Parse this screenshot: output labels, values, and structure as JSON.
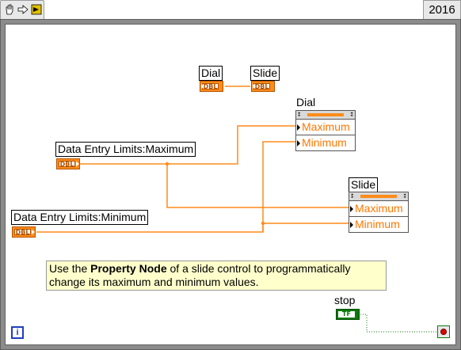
{
  "toolbar": {
    "icons": [
      "hand-icon",
      "run-arrow-icon",
      "block-diagram-icon"
    ]
  },
  "version": "2016",
  "labels": {
    "dial_indicator": "Dial",
    "slide_indicator": "Slide",
    "dial_node": "Dial",
    "slide_node": "Slide",
    "max_control": "Data Entry Limits:Maximum",
    "min_control": "Data Entry Limits:Minimum",
    "stop": "stop"
  },
  "terminals": {
    "dbl": "DBL",
    "tf": "TF"
  },
  "property_nodes": {
    "dial": {
      "properties": [
        "Maximum",
        "Minimum"
      ]
    },
    "slide": {
      "properties": [
        "Maximum",
        "Minimum"
      ]
    }
  },
  "comment": {
    "prefix": "Use  the ",
    "bold": "Property Node",
    "suffix": " of a slide control to programmatically change its maximum and minimum values."
  },
  "iteration_terminal": "i",
  "colors": {
    "wire_orange": "#ff8c1a",
    "loop_border": "#8c8c8c",
    "boolean_green": "#0c7a0c",
    "comment_bg": "#ffffcc"
  }
}
